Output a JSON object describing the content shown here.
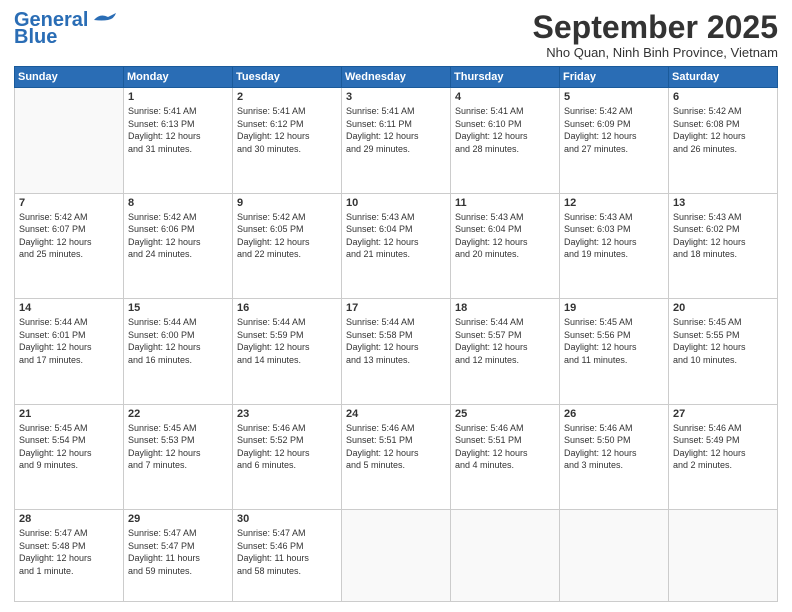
{
  "header": {
    "logo_line1": "General",
    "logo_line2": "Blue",
    "month": "September 2025",
    "location": "Nho Quan, Ninh Binh Province, Vietnam"
  },
  "days_of_week": [
    "Sunday",
    "Monday",
    "Tuesday",
    "Wednesday",
    "Thursday",
    "Friday",
    "Saturday"
  ],
  "weeks": [
    [
      {
        "day": "",
        "info": ""
      },
      {
        "day": "1",
        "info": "Sunrise: 5:41 AM\nSunset: 6:13 PM\nDaylight: 12 hours\nand 31 minutes."
      },
      {
        "day": "2",
        "info": "Sunrise: 5:41 AM\nSunset: 6:12 PM\nDaylight: 12 hours\nand 30 minutes."
      },
      {
        "day": "3",
        "info": "Sunrise: 5:41 AM\nSunset: 6:11 PM\nDaylight: 12 hours\nand 29 minutes."
      },
      {
        "day": "4",
        "info": "Sunrise: 5:41 AM\nSunset: 6:10 PM\nDaylight: 12 hours\nand 28 minutes."
      },
      {
        "day": "5",
        "info": "Sunrise: 5:42 AM\nSunset: 6:09 PM\nDaylight: 12 hours\nand 27 minutes."
      },
      {
        "day": "6",
        "info": "Sunrise: 5:42 AM\nSunset: 6:08 PM\nDaylight: 12 hours\nand 26 minutes."
      }
    ],
    [
      {
        "day": "7",
        "info": "Sunrise: 5:42 AM\nSunset: 6:07 PM\nDaylight: 12 hours\nand 25 minutes."
      },
      {
        "day": "8",
        "info": "Sunrise: 5:42 AM\nSunset: 6:06 PM\nDaylight: 12 hours\nand 24 minutes."
      },
      {
        "day": "9",
        "info": "Sunrise: 5:42 AM\nSunset: 6:05 PM\nDaylight: 12 hours\nand 22 minutes."
      },
      {
        "day": "10",
        "info": "Sunrise: 5:43 AM\nSunset: 6:04 PM\nDaylight: 12 hours\nand 21 minutes."
      },
      {
        "day": "11",
        "info": "Sunrise: 5:43 AM\nSunset: 6:04 PM\nDaylight: 12 hours\nand 20 minutes."
      },
      {
        "day": "12",
        "info": "Sunrise: 5:43 AM\nSunset: 6:03 PM\nDaylight: 12 hours\nand 19 minutes."
      },
      {
        "day": "13",
        "info": "Sunrise: 5:43 AM\nSunset: 6:02 PM\nDaylight: 12 hours\nand 18 minutes."
      }
    ],
    [
      {
        "day": "14",
        "info": "Sunrise: 5:44 AM\nSunset: 6:01 PM\nDaylight: 12 hours\nand 17 minutes."
      },
      {
        "day": "15",
        "info": "Sunrise: 5:44 AM\nSunset: 6:00 PM\nDaylight: 12 hours\nand 16 minutes."
      },
      {
        "day": "16",
        "info": "Sunrise: 5:44 AM\nSunset: 5:59 PM\nDaylight: 12 hours\nand 14 minutes."
      },
      {
        "day": "17",
        "info": "Sunrise: 5:44 AM\nSunset: 5:58 PM\nDaylight: 12 hours\nand 13 minutes."
      },
      {
        "day": "18",
        "info": "Sunrise: 5:44 AM\nSunset: 5:57 PM\nDaylight: 12 hours\nand 12 minutes."
      },
      {
        "day": "19",
        "info": "Sunrise: 5:45 AM\nSunset: 5:56 PM\nDaylight: 12 hours\nand 11 minutes."
      },
      {
        "day": "20",
        "info": "Sunrise: 5:45 AM\nSunset: 5:55 PM\nDaylight: 12 hours\nand 10 minutes."
      }
    ],
    [
      {
        "day": "21",
        "info": "Sunrise: 5:45 AM\nSunset: 5:54 PM\nDaylight: 12 hours\nand 9 minutes."
      },
      {
        "day": "22",
        "info": "Sunrise: 5:45 AM\nSunset: 5:53 PM\nDaylight: 12 hours\nand 7 minutes."
      },
      {
        "day": "23",
        "info": "Sunrise: 5:46 AM\nSunset: 5:52 PM\nDaylight: 12 hours\nand 6 minutes."
      },
      {
        "day": "24",
        "info": "Sunrise: 5:46 AM\nSunset: 5:51 PM\nDaylight: 12 hours\nand 5 minutes."
      },
      {
        "day": "25",
        "info": "Sunrise: 5:46 AM\nSunset: 5:51 PM\nDaylight: 12 hours\nand 4 minutes."
      },
      {
        "day": "26",
        "info": "Sunrise: 5:46 AM\nSunset: 5:50 PM\nDaylight: 12 hours\nand 3 minutes."
      },
      {
        "day": "27",
        "info": "Sunrise: 5:46 AM\nSunset: 5:49 PM\nDaylight: 12 hours\nand 2 minutes."
      }
    ],
    [
      {
        "day": "28",
        "info": "Sunrise: 5:47 AM\nSunset: 5:48 PM\nDaylight: 12 hours\nand 1 minute."
      },
      {
        "day": "29",
        "info": "Sunrise: 5:47 AM\nSunset: 5:47 PM\nDaylight: 11 hours\nand 59 minutes."
      },
      {
        "day": "30",
        "info": "Sunrise: 5:47 AM\nSunset: 5:46 PM\nDaylight: 11 hours\nand 58 minutes."
      },
      {
        "day": "",
        "info": ""
      },
      {
        "day": "",
        "info": ""
      },
      {
        "day": "",
        "info": ""
      },
      {
        "day": "",
        "info": ""
      }
    ]
  ]
}
